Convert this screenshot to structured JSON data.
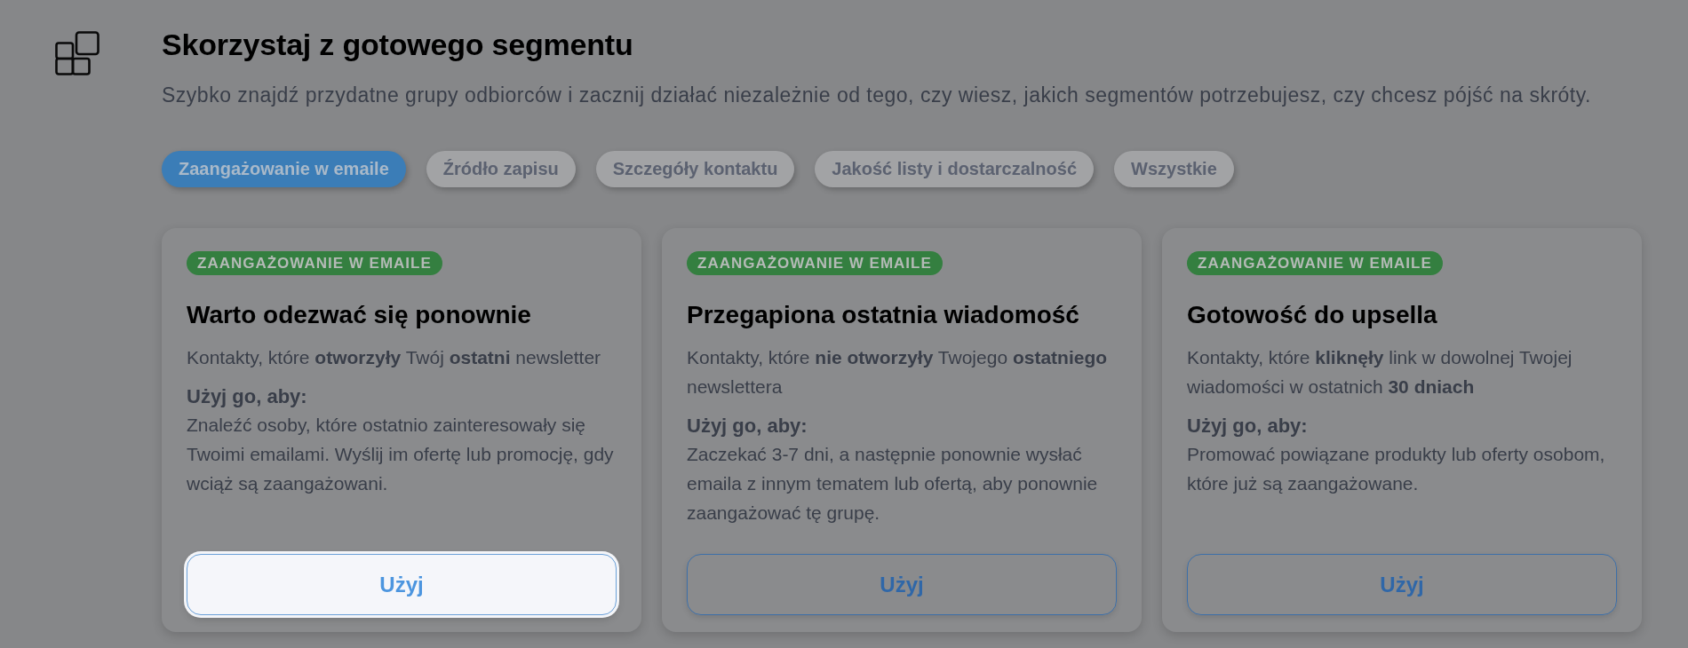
{
  "header": {
    "title": "Skorzystaj z gotowego segmentu",
    "subtitle": "Szybko znajdź przydatne grupy odbiorców i zacznij działać niezależnie od tego, czy wiesz, jakich segmentów potrzebujesz, czy chcesz pójść na skróty."
  },
  "tabs": [
    {
      "label": "Zaangażowanie w emaile",
      "selected": true
    },
    {
      "label": "Źródło zapisu",
      "selected": false
    },
    {
      "label": "Szczegóły kontaktu",
      "selected": false
    },
    {
      "label": "Jakość listy i dostarczalność",
      "selected": false
    },
    {
      "label": "Wszystkie",
      "selected": false
    }
  ],
  "cards": [
    {
      "tag": "ZAANGAŻOWANIE W EMAILE",
      "title": "Warto odezwać się ponownie",
      "description": "Kontakty, które **otworzyły** Twój **ostatni** newsletter",
      "usage_label": "Użyj go, aby:",
      "usage": "Znaleźć osoby, które ostatnio zainteresowały się Twoimi emailami. Wyślij im ofertę lub promocję, gdy wciąż są zaangażowani.",
      "button": {
        "label": "Użyj",
        "highlighted": true
      }
    },
    {
      "tag": "ZAANGAŻOWANIE W EMAILE",
      "title": "Przegapiona ostatnia wiadomość",
      "description": "Kontakty, które **nie otworzyły** Twojego **ostatniego** newslettera",
      "usage_label": "Użyj go, aby:",
      "usage": "Zaczekać 3-7 dni, a następnie ponownie wysłać emaila z innym tematem lub ofertą, aby ponownie zaangażować tę grupę.",
      "button": {
        "label": "Użyj",
        "highlighted": false
      }
    },
    {
      "tag": "ZAANGAŻOWANIE W EMAILE",
      "title": "Gotowość do upsella",
      "description": "Kontakty, które **kliknęły** link w dowolnej Twojej wiadomości w ostatnich **30 dniach**",
      "usage_label": "Użyj go, aby:",
      "usage": "Promować powiązane produkty lub oferty osobom, które już są zaangażowane.",
      "button": {
        "label": "Użyj",
        "highlighted": false
      }
    }
  ]
}
